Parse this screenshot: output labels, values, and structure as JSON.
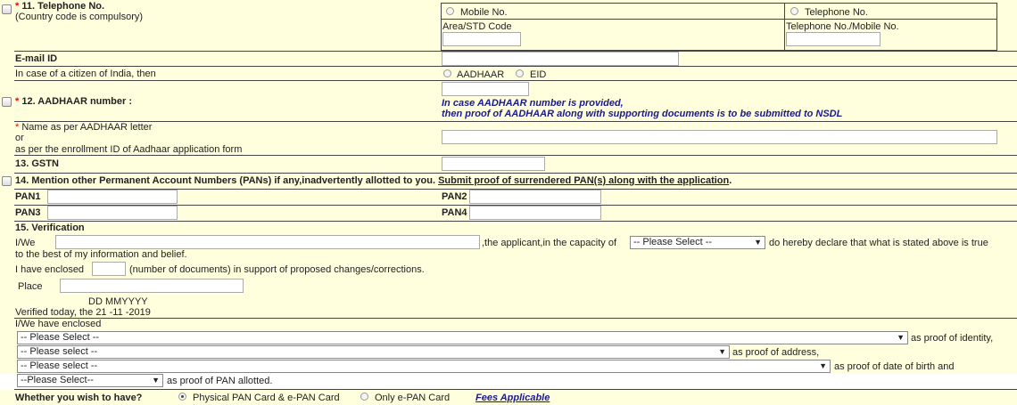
{
  "telephone": {
    "label": "11. Telephone No.",
    "note": "(Country code is compulsory)",
    "mobile_label": "Mobile No.",
    "telephone_label": "Telephone No.",
    "area_label": "Area/STD Code",
    "tel_mobile_label": "Telephone No./Mobile No."
  },
  "email": {
    "label": "E-mail ID",
    "value": ""
  },
  "aadhaar": {
    "citizen_label": "In case of a citizen of India, then",
    "opt_aadhaar": "AADHAAR",
    "opt_eid": "EID",
    "number_label": "12. AADHAAR number :",
    "note_line1": "In case AADHAAR number is provided,",
    "note_line2": "then proof of AADHAAR along with supporting documents is to be submitted to NSDL",
    "name_line1": "Name as per AADHAAR letter",
    "name_line2": "or",
    "name_line3": "as per the enrollment ID of Aadhaar application form"
  },
  "gstn": {
    "label": "13. GSTN"
  },
  "other_pans": {
    "label": "14. Mention other Permanent Account Numbers (PANs) if any,inadvertently allotted to you.",
    "link": "Submit proof of surrendered PAN(s) along with the application",
    "link_suffix": ".",
    "pan1": "PAN1",
    "pan2": "PAN2",
    "pan3": "PAN3",
    "pan4": "PAN4"
  },
  "verification": {
    "label": "15. Verification",
    "iwe": "I/We",
    "capacity_text": ",the applicant,in the capacity of",
    "capacity_select": "-- Please Select --",
    "declare_text": "do hereby declare that what is stated above is true",
    "declare_text2": "to the best of my information and belief.",
    "enclosed_prefix": "I have enclosed",
    "enclosed_suffix": "(number of documents) in support of proposed changes/corrections.",
    "place_label": "Place",
    "date_format": "DD MMYYYY",
    "verified_prefix": "Verified today, the",
    "verified_date": "21 -11 -2019",
    "have_enclosed": "I/We have enclosed",
    "identity_select": "-- Please Select --",
    "identity_suffix": "as proof of identity,",
    "address_select": "-- Please select --",
    "address_suffix": "as proof of address,",
    "dob_select": "-- Please select --",
    "dob_suffix": "as proof of date of birth and",
    "pan_select": "--Please Select--",
    "pan_suffix": "as proof of PAN allotted."
  },
  "pan_card": {
    "question": "Whether you wish to have?",
    "opt_physical": "Physical PAN Card & e-PAN Card",
    "opt_epan": "Only e-PAN Card",
    "fees": "Fees Applicable"
  }
}
